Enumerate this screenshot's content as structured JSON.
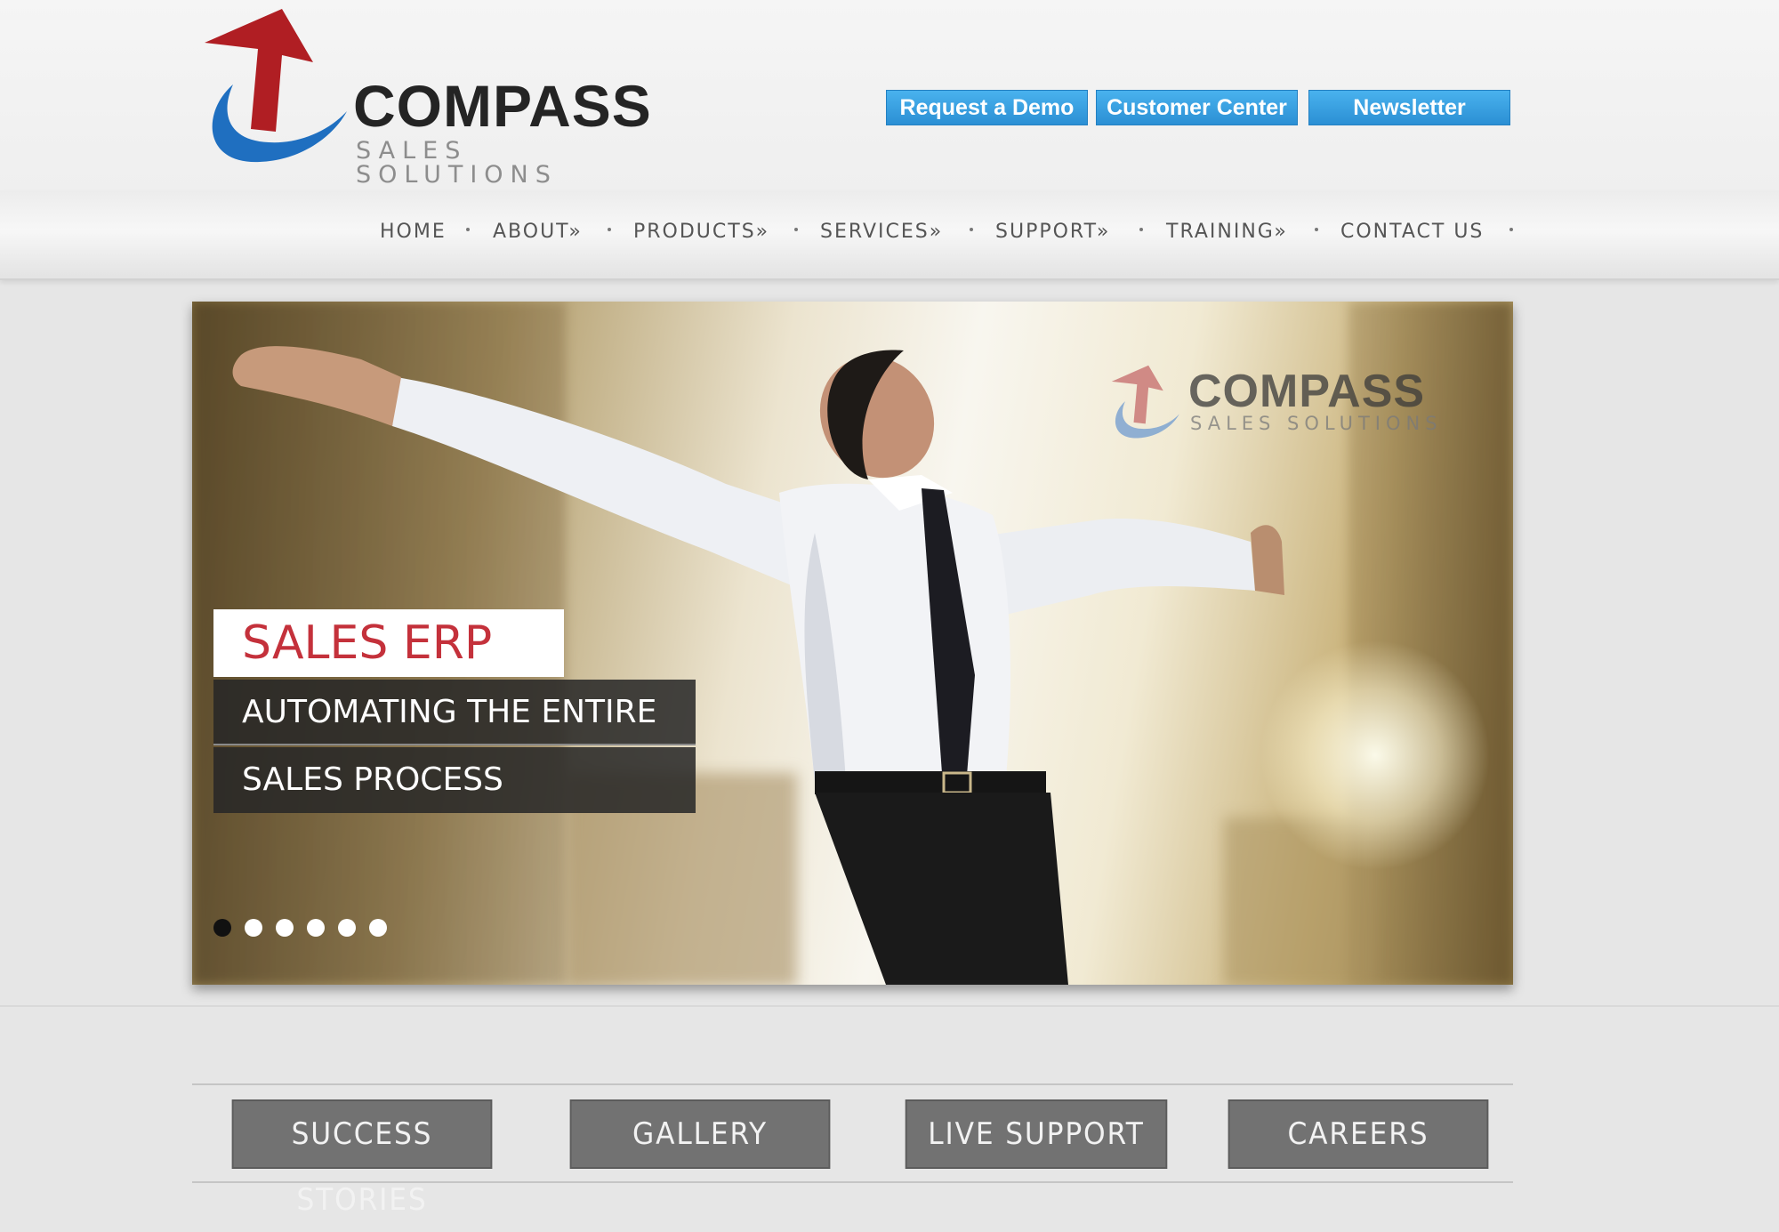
{
  "brand": {
    "name": "COMPASS",
    "tagline": "SALES SOLUTIONS",
    "arrow_color": "#b01e23",
    "swoosh_color": "#1f6fc0"
  },
  "top_buttons": [
    {
      "label": "Request a Demo"
    },
    {
      "label": "Customer Center"
    },
    {
      "label": "Newsletter"
    }
  ],
  "nav": {
    "items": [
      {
        "label": "HOME"
      },
      {
        "label": "ABOUT»"
      },
      {
        "label": "PRODUCTS»"
      },
      {
        "label": "SERVICES»"
      },
      {
        "label": "SUPPORT»"
      },
      {
        "label": "TRAINING»"
      },
      {
        "label": "CONTACT US"
      }
    ]
  },
  "hero": {
    "logo_word": "COMPASS",
    "logo_sub": "SALES SOLUTIONS",
    "title": "SALES ERP",
    "line1": "AUTOMATING THE ENTIRE",
    "line2": "SALES PROCESS",
    "slide_count": 6,
    "active_slide": 1
  },
  "bottom_buttons": [
    {
      "label": "SUCCESS STORIES"
    },
    {
      "label": "GALLERY"
    },
    {
      "label": "LIVE SUPPORT"
    },
    {
      "label": "CAREERS"
    }
  ],
  "colors": {
    "accent_blue": "#2b8fd4",
    "title_red": "#c4313b",
    "button_gray": "#727272"
  }
}
